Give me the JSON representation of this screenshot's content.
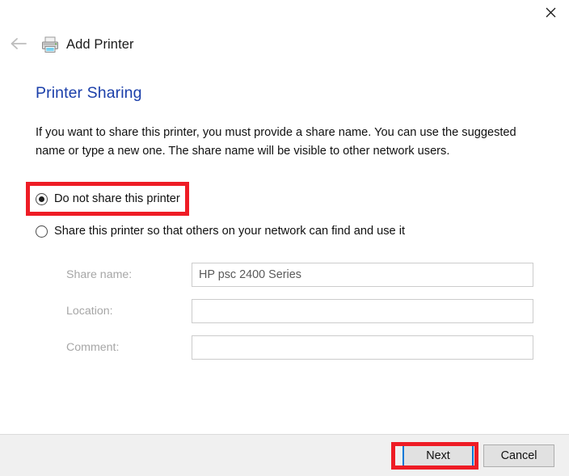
{
  "window": {
    "title": "Add Printer",
    "close_label": "Close",
    "back_label": "Back",
    "printer_icon": "printer-icon",
    "close_icon": "close-icon",
    "back_icon": "back-arrow-icon"
  },
  "page": {
    "heading": "Printer Sharing",
    "description": "If you want to share this printer, you must provide a share name. You can use the suggested name or type a new one. The share name will be visible to other network users."
  },
  "options": [
    {
      "label": "Do not share this printer",
      "checked": true
    },
    {
      "label": "Share this printer so that others on your network can find and use it",
      "checked": false
    }
  ],
  "fields": [
    {
      "label": "Share name:",
      "value": "HP psc 2400 Series",
      "placeholder": "",
      "disabled": true
    },
    {
      "label": "Location:",
      "value": "",
      "placeholder": "",
      "disabled": true
    },
    {
      "label": "Comment:",
      "value": "",
      "placeholder": "",
      "disabled": true
    }
  ],
  "footer": {
    "next_label": "Next",
    "cancel_label": "Cancel"
  },
  "annotations": {
    "highlight_color": "#ee1c25",
    "focus_color": "#0078d7",
    "targets": [
      "do-not-share-this-printer-option",
      "next-button"
    ]
  }
}
